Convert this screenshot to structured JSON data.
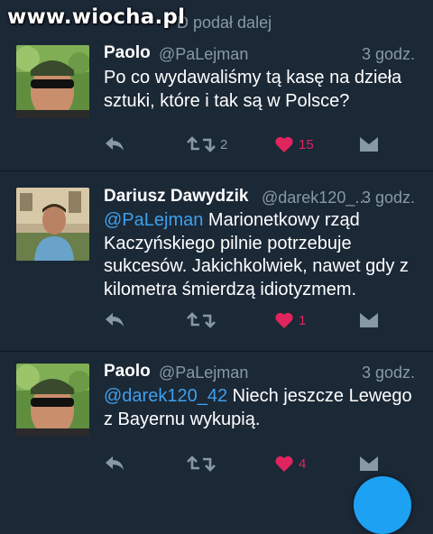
{
  "watermark": "www.wiocha.pl",
  "retweet_context": "D podał dalej",
  "colors": {
    "background": "#1b2836",
    "mention": "#3ea1ec",
    "like": "#e0245e",
    "secondary": "#8899a6"
  },
  "tweets": [
    {
      "name": "Paolo",
      "handle": "@PaLejman",
      "time": "3 godz.",
      "mention": "",
      "text": "Po co wydawaliśmy tą kasę na dzieła sztuki, które i tak są w Polsce?",
      "retweets": "2",
      "likes": "15",
      "liked": true
    },
    {
      "name": "Dariusz Dawydzik",
      "handle": "@darek120_...",
      "time": "3 godz.",
      "mention": "@PaLejman",
      "text": " Marionetkowy rząd Kaczyńskiego pilnie potrzebuje sukcesów. Jakichkolwiek, nawet gdy z kilometra śmierdzą idiotyzmem.",
      "retweets": "",
      "likes": "1",
      "liked": true
    },
    {
      "name": "Paolo",
      "handle": "@PaLejman",
      "time": "3 godz.",
      "mention": "@darek120_42",
      "text": " Niech jeszcze Lewego z Bayernu wykupią.",
      "retweets": "",
      "likes": "4",
      "liked": true
    }
  ]
}
